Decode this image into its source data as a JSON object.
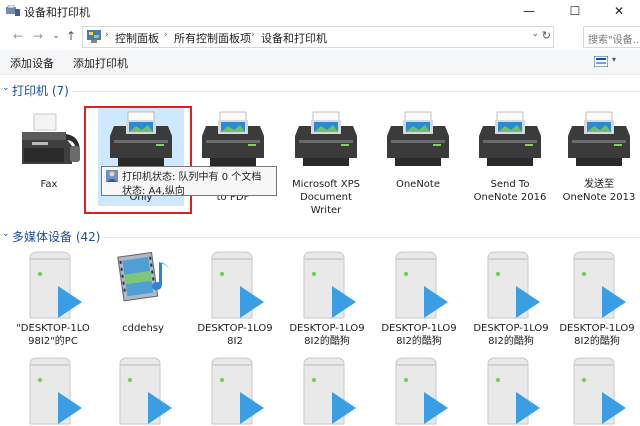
{
  "window": {
    "title": "设备和打印机",
    "minimize": "—",
    "maximize": "☐",
    "close": "✕"
  },
  "address": {
    "back": "←",
    "forward": "→",
    "dropdown": "⌄",
    "up": "↑",
    "sep": "›",
    "crumbs": [
      "控制面板",
      "所有控制面板项",
      "设备和打印机"
    ],
    "refresh": "↻",
    "search_placeholder": "搜索\"设备..."
  },
  "toolbar": {
    "add_device": "添加设备",
    "add_printer": "添加打印机",
    "view_dropdown": "▾"
  },
  "printers": {
    "header": "打印机 (7)",
    "items": [
      {
        "label": "Fax",
        "icon": "fax-icon"
      },
      {
        "label": "Gen              \nOnly",
        "icon": "printer-icon"
      },
      {
        "label": "\nto PDF",
        "icon": "printer-icon"
      },
      {
        "label": "Microsoft XPS\nDocument\nWriter",
        "icon": "printer-icon"
      },
      {
        "label": "OneNote",
        "icon": "printer-icon"
      },
      {
        "label": "Send To\nOneNote 2016",
        "icon": "printer-icon"
      },
      {
        "label": "发送至\nOneNote 2013",
        "icon": "printer-icon"
      }
    ]
  },
  "tooltip": {
    "line1": "打印机状态: 队列中有 0 个文档",
    "line2": "状态: A4,纵向"
  },
  "media": {
    "header": "多媒体设备 (42)",
    "items": [
      {
        "label": "\"DESKTOP-1LO\n98I2\"的PC",
        "icon": "media-server-icon"
      },
      {
        "label": "cddehsy",
        "icon": "media-library-icon"
      },
      {
        "label": "DESKTOP-1LO9\n8I2",
        "icon": "media-server-icon"
      },
      {
        "label": "DESKTOP-1LO9\n8I2的酷狗",
        "icon": "media-server-icon"
      },
      {
        "label": "DESKTOP-1LO9\n8I2的酷狗",
        "icon": "media-server-icon"
      },
      {
        "label": "DESKTOP-1LO9\n8I2的酷狗",
        "icon": "media-server-icon"
      },
      {
        "label": "DESKTOP-1LO9\n8I2的酷狗",
        "icon": "media-server-icon"
      }
    ]
  }
}
